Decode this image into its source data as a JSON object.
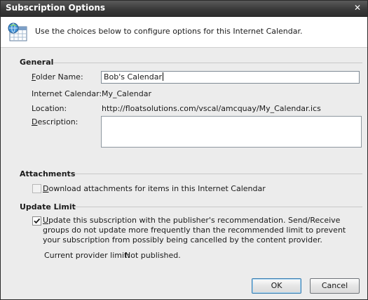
{
  "window": {
    "title": "Subscription Options",
    "close_glyph": "✕"
  },
  "header": {
    "icon": "internet-calendar-icon",
    "description": "Use the choices below to configure options for this Internet Calendar."
  },
  "general": {
    "section_title": "General",
    "folder_name_label_prefix": "",
    "folder_name_label_underlined": "F",
    "folder_name_label_rest": "older Name:",
    "folder_name_value": "Bob's Calendar",
    "internet_calendar_label": "Internet Calendar:",
    "internet_calendar_value": "My_Calendar",
    "location_label": "Location:",
    "location_value": "http://floatsolutions.com/vscal/amcquay/My_Calendar.ics",
    "description_label_underlined": "D",
    "description_label_rest": "escription:",
    "description_value": ""
  },
  "attachments": {
    "section_title": "Attachments",
    "download_label_underlined": "D",
    "download_label_rest": "ownload attachments for items in this Internet Calendar",
    "download_checked": false
  },
  "update_limit": {
    "section_title": "Update Limit",
    "update_label_underlined": "U",
    "update_label_rest": "pdate this subscription with the publisher's recommendation. Send/Receive groups do not update more frequently than the recommended limit to prevent your subscription from possibly being cancelled by the content provider.",
    "update_checked": true,
    "provider_limit_label": "Current provider limit:",
    "provider_limit_value": "Not published."
  },
  "buttons": {
    "ok_label": "OK",
    "cancel_label": "Cancel"
  },
  "colors": {
    "titlebar": "#3a3a3a",
    "dialog_bg": "#ececec",
    "default_button_border": "#3c7fb1"
  }
}
